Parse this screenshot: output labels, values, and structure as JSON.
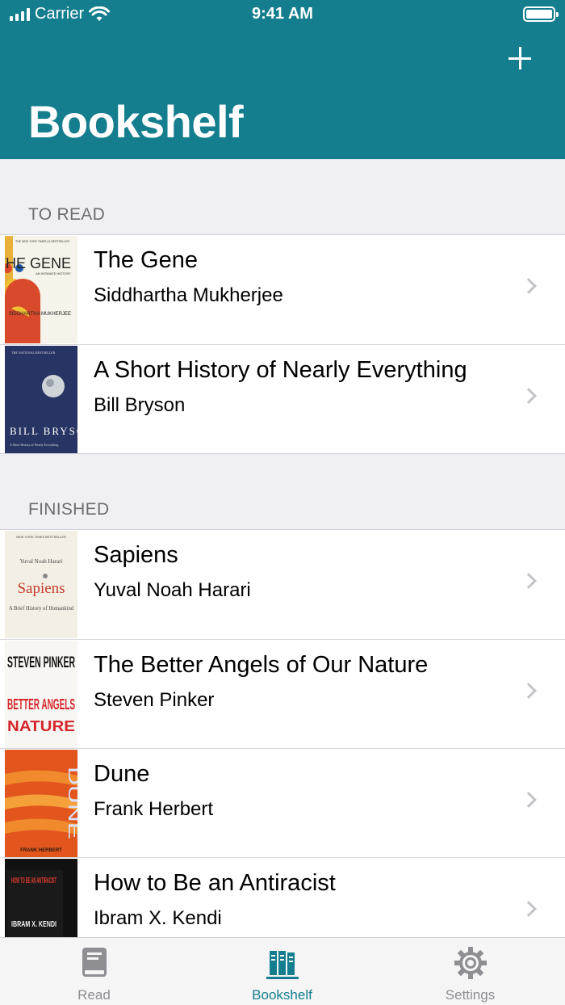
{
  "status_bar": {
    "carrier": "Carrier",
    "time": "9:41 AM"
  },
  "header": {
    "title": "Bookshelf"
  },
  "sections": [
    {
      "title": "TO READ",
      "books": [
        {
          "title": "The Gene",
          "author": "Siddhartha Mukherjee",
          "cover": {
            "top": "THE NEW YORK TIMES #1 BESTSELLER",
            "heading": "THE GENE",
            "sub": "AN INTIMATE HISTORY",
            "name": "SIDDHARTHA MUKHERJEE"
          }
        },
        {
          "title": "A Short History of Nearly Everything",
          "author": "Bill Bryson",
          "cover": {
            "top": "THE NATIONAL BESTSELLER",
            "heading": "BILL BRYSON",
            "sub": "A Short History of Nearly Everything"
          }
        }
      ]
    },
    {
      "title": "FINISHED",
      "books": [
        {
          "title": "Sapiens",
          "author": "Yuval Noah Harari",
          "cover": {
            "top": "NEW YORK TIMES BESTSELLER",
            "name": "Yuval Noah Harari",
            "heading": "Sapiens",
            "sub": "A Brief History of Humankind"
          }
        },
        {
          "title": "The Better Angels of Our Nature",
          "author": "Steven Pinker",
          "cover": {
            "name": "STEVEN PINKER",
            "heading": "BETTER ANGELS",
            "sub": "NATURE"
          }
        },
        {
          "title": "Dune",
          "author": "Frank Herbert",
          "cover": {
            "heading": "DUNE",
            "name": "FRANK HERBERT"
          }
        },
        {
          "title": "How to Be an Antiracist",
          "author": "Ibram X. Kendi",
          "cover": {
            "heading": "HOW TO BE AN ANTIRACIST",
            "name": "IBRAM X. KENDI"
          }
        }
      ]
    }
  ],
  "tab_bar": {
    "tabs": [
      {
        "label": "Read",
        "icon": "book-icon",
        "active": false
      },
      {
        "label": "Bookshelf",
        "icon": "bookshelf-icon",
        "active": true
      },
      {
        "label": "Settings",
        "icon": "gear-icon",
        "active": false
      }
    ]
  },
  "colors": {
    "accent": "#147e8f",
    "background": "#efeff4",
    "inactive_tab": "#8e8e93"
  }
}
